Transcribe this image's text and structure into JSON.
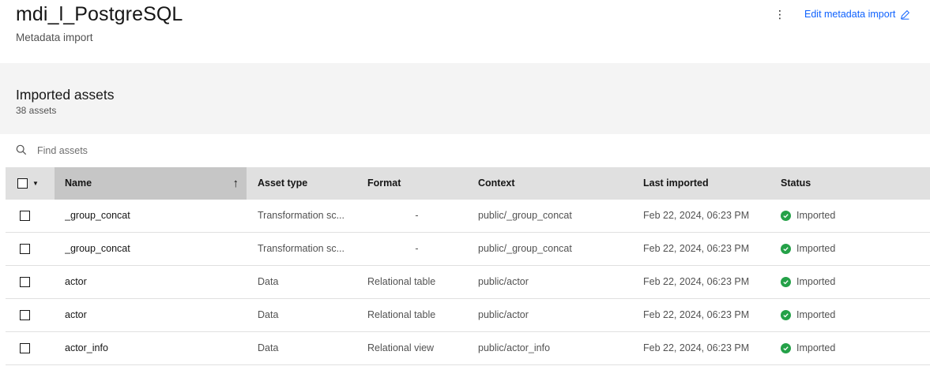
{
  "header": {
    "title": "mdi_l_PostgreSQL",
    "subtitle": "Metadata import",
    "overflow_icon": "overflow-menu-vertical-icon",
    "edit_label": "Edit metadata import",
    "edit_icon": "pencil-icon",
    "accent_color": "#0f62fe"
  },
  "assets_panel": {
    "title": "Imported assets",
    "count": "38 assets"
  },
  "search": {
    "placeholder": "Find assets",
    "value": ""
  },
  "table": {
    "columns": {
      "name": "Name",
      "asset_type": "Asset type",
      "format": "Format",
      "context": "Context",
      "last_imported": "Last imported",
      "status": "Status"
    },
    "sort": {
      "column": "Name",
      "direction": "ascending"
    },
    "rows": [
      {
        "name": "_group_concat",
        "asset_type": "Transformation sc...",
        "format": "-",
        "context": "public/_group_concat",
        "last_imported": "Feb 22, 2024, 06:23 PM",
        "status": "Imported"
      },
      {
        "name": "_group_concat",
        "asset_type": "Transformation sc...",
        "format": "-",
        "context": "public/_group_concat",
        "last_imported": "Feb 22, 2024, 06:23 PM",
        "status": "Imported"
      },
      {
        "name": "actor",
        "asset_type": "Data",
        "format": "Relational table",
        "context": "public/actor",
        "last_imported": "Feb 22, 2024, 06:23 PM",
        "status": "Imported"
      },
      {
        "name": "actor",
        "asset_type": "Data",
        "format": "Relational table",
        "context": "public/actor",
        "last_imported": "Feb 22, 2024, 06:23 PM",
        "status": "Imported"
      },
      {
        "name": "actor_info",
        "asset_type": "Data",
        "format": "Relational view",
        "context": "public/actor_info",
        "last_imported": "Feb 22, 2024, 06:23 PM",
        "status": "Imported"
      }
    ],
    "status_color": "#24a148"
  }
}
